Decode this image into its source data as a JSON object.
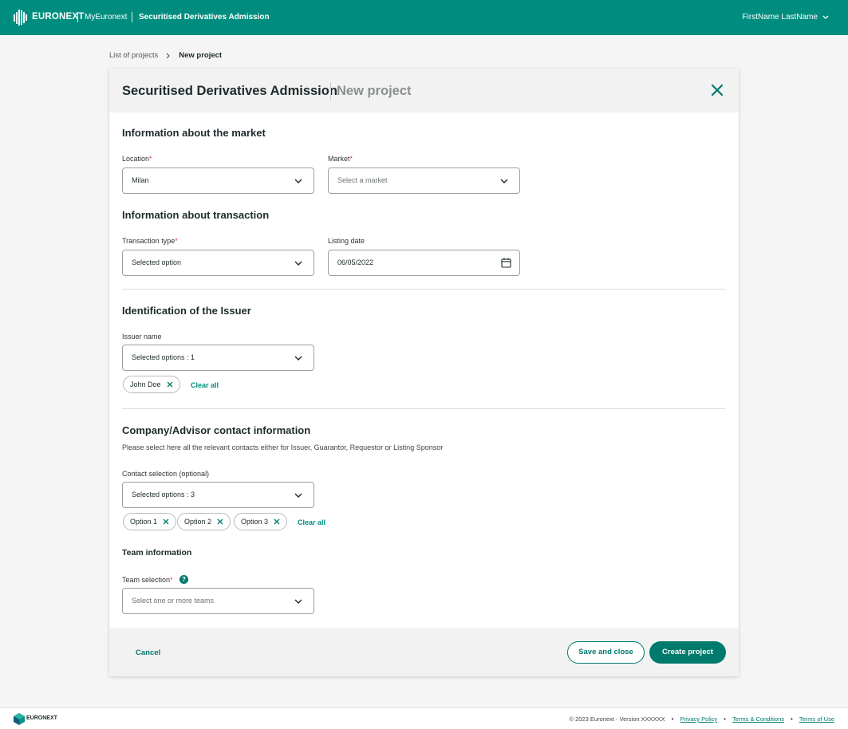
{
  "header": {
    "brand": "EURONEXT",
    "my_link": "MyEuronext",
    "app_name": "Securitised Derivatives Admission",
    "user_name": "FirstName LastName"
  },
  "breadcrumb": {
    "parent": "List of projects",
    "current": "New project"
  },
  "card": {
    "title": "Securitised Derivatives Admission",
    "subtitle": "New project"
  },
  "market_section": {
    "heading": "Information about the market",
    "location_label": "Location",
    "location_value": "Milan",
    "market_label": "Market",
    "market_placeholder": "Select a market"
  },
  "transaction_section": {
    "heading": "Information about transaction",
    "type_label": "Transaction type",
    "type_value": "Selected option",
    "date_label": "Listing date",
    "date_value": "06/05/2022"
  },
  "issuer_section": {
    "heading": "Identification of the Issuer",
    "name_label": "Issuer name",
    "name_value": "Selected options : 1",
    "chips": [
      "John Doe"
    ],
    "clear_all": "Clear all"
  },
  "contact_section": {
    "heading": "Company/Advisor contact information",
    "description": "Please select here all the relevant contacts either for Issuer, Guarantor, Requestor or Listing Sponsor",
    "selection_label": "Contact selection (optional)",
    "selection_value": "Selected options : 3",
    "chips": [
      "Option 1",
      "Option 2",
      "Option 3"
    ],
    "clear_all": "Clear all"
  },
  "team_section": {
    "heading": "Team information",
    "selection_label": "Team selection",
    "selection_placeholder": "Select one or more teams",
    "help_glyph": "?"
  },
  "required_mark": "*",
  "actions": {
    "cancel": "Cancel",
    "save_close": "Save and close",
    "create": "Create project"
  },
  "footer": {
    "brand": "EURONEXT",
    "copyright": "© 2023 Euronext - Version XXXXXX",
    "privacy": "Privacy Policy",
    "terms_conditions": "Terms & Conditions",
    "terms_use": "Terms of Use"
  },
  "colors": {
    "brand_teal": "#008d7f",
    "button_teal": "#007a6d",
    "required_red": "#e03a3a"
  },
  "icons": {
    "logo": "euronext-logo-icon",
    "chevron": "chevron-down-icon",
    "close": "close-icon",
    "calendar": "calendar-icon",
    "remove": "remove-chip-icon",
    "help": "help-icon"
  }
}
